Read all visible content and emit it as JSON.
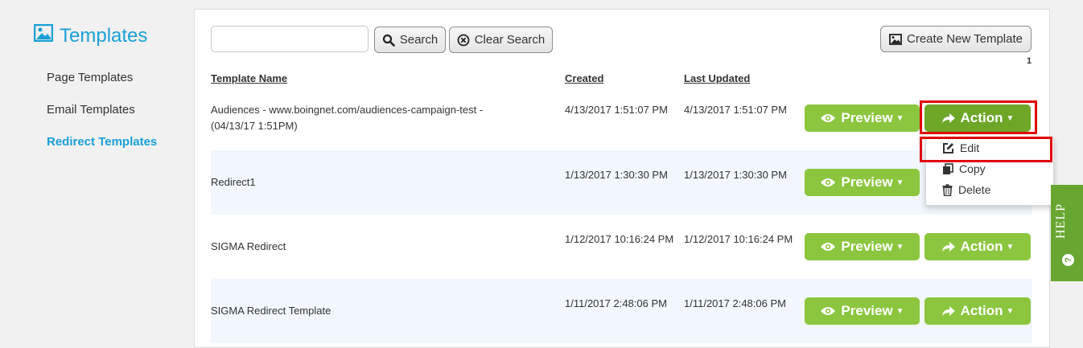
{
  "sidebar": {
    "title": "Templates",
    "items": [
      {
        "label": "Page Templates"
      },
      {
        "label": "Email Templates"
      },
      {
        "label": "Redirect Templates"
      }
    ]
  },
  "toolbar": {
    "search_value": "",
    "search_label": "Search",
    "clear_label": "Clear Search",
    "create_label": "Create New Template"
  },
  "pagination": {
    "page": "1"
  },
  "table": {
    "headers": {
      "name": "Template Name",
      "created": "Created",
      "updated": "Last Updated"
    },
    "rows": [
      {
        "name_line1": "Audiences - www.boingnet.com/audiences-campaign-test -",
        "name_line2": "(04/13/17 1:51PM)",
        "created": "4/13/2017 1:51:07 PM",
        "updated": "4/13/2017 1:51:07 PM"
      },
      {
        "name_line1": "Redirect1",
        "created": "1/13/2017 1:30:30 PM",
        "updated": "1/13/2017 1:30:30 PM"
      },
      {
        "name_line1": "SIGMA Redirect",
        "created": "1/12/2017 10:16:24 PM",
        "updated": "1/12/2017 10:16:24 PM"
      },
      {
        "name_line1": "SIGMA Redirect Template",
        "created": "1/11/2017 2:48:06 PM",
        "updated": "1/11/2017 2:48:06 PM"
      }
    ]
  },
  "buttons": {
    "preview": "Preview",
    "action": "Action"
  },
  "action_menu": {
    "items": [
      {
        "label": "Edit",
        "icon": "edit-icon"
      },
      {
        "label": "Copy",
        "icon": "copy-icon"
      },
      {
        "label": "Delete",
        "icon": "trash-icon"
      }
    ]
  },
  "help": {
    "label": "HELP",
    "icon_glyph": "?"
  },
  "colors": {
    "accent_blue": "#1ba0d7",
    "green": "#8cc63f",
    "green_dark": "#6ea628",
    "highlight_red": "#e00000",
    "help_green": "#68a631"
  }
}
